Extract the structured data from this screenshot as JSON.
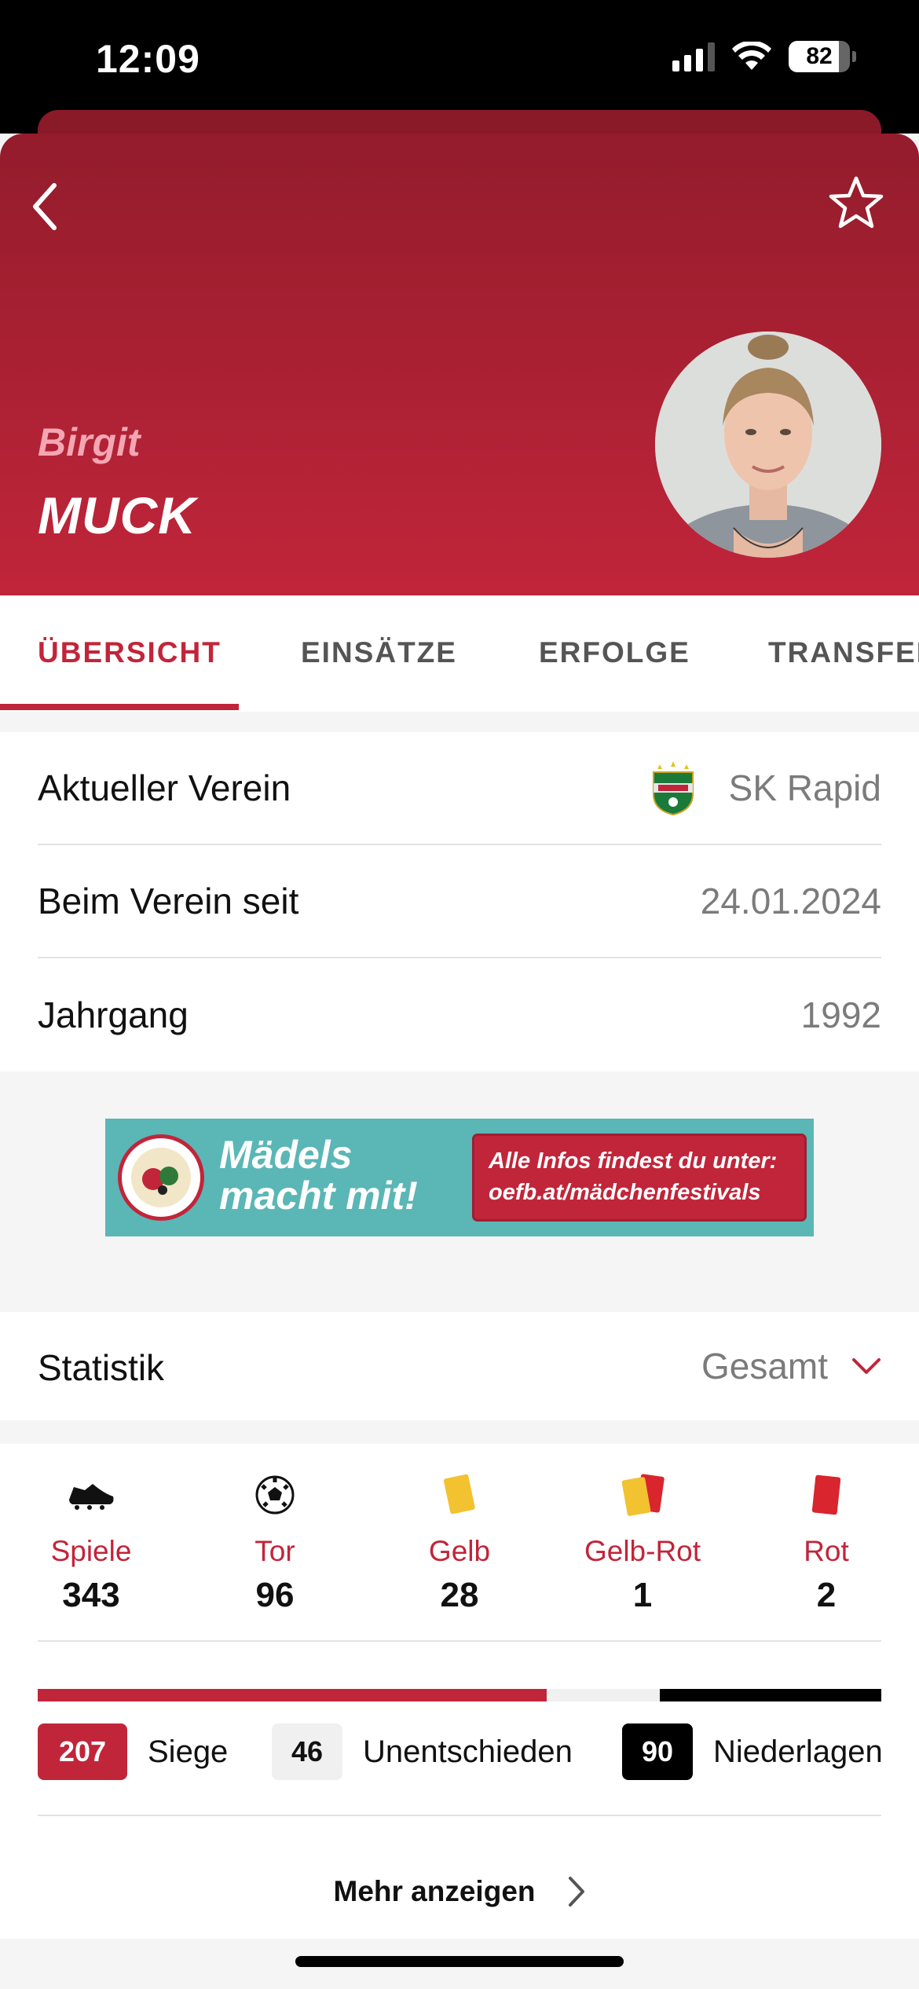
{
  "status_bar": {
    "time": "12:09",
    "battery": "82",
    "battery_level": 0.82
  },
  "player": {
    "first_name": "Birgit",
    "last_name": "MUCK"
  },
  "tabs": [
    {
      "label": "ÜBERSICHT",
      "active": true
    },
    {
      "label": "EINSÄTZE",
      "active": false
    },
    {
      "label": "ERFOLGE",
      "active": false
    },
    {
      "label": "TRANSFER",
      "active": false
    }
  ],
  "info": [
    {
      "label": "Aktueller Verein",
      "value": "SK Rapid",
      "icon": "club-logo-icon"
    },
    {
      "label": "Beim Verein seit",
      "value": "24.01.2024"
    },
    {
      "label": "Jahrgang",
      "value": "1992"
    }
  ],
  "banner": {
    "title_line1": "Mädels",
    "title_line2": "macht mit!",
    "info_line1": "Alle Infos findest du unter:",
    "info_line2": "oefb.at/mädchenfestivals"
  },
  "statistics": {
    "title": "Statistik",
    "filter": "Gesamt",
    "items": [
      {
        "label": "Spiele",
        "value": "343",
        "icon": "boot-icon"
      },
      {
        "label": "Tor",
        "value": "96",
        "icon": "ball-icon"
      },
      {
        "label": "Gelb",
        "value": "28",
        "icon": "yellow-card-icon"
      },
      {
        "label": "Gelb-Rot",
        "value": "1",
        "icon": "yellow-red-card-icon"
      },
      {
        "label": "Rot",
        "value": "2",
        "icon": "red-card-icon"
      }
    ],
    "results": [
      {
        "label": "Siege",
        "value": "207",
        "count": 207,
        "color": "#c1253a"
      },
      {
        "label": "Unentschieden",
        "value": "46",
        "count": 46,
        "color": "#f0f0f0"
      },
      {
        "label": "Niederlagen",
        "value": "90",
        "count": 90,
        "color": "#000000"
      }
    ],
    "more_label": "Mehr anzeigen"
  },
  "colors": {
    "primary": "#c1253a",
    "header_dark": "#931c2c"
  }
}
